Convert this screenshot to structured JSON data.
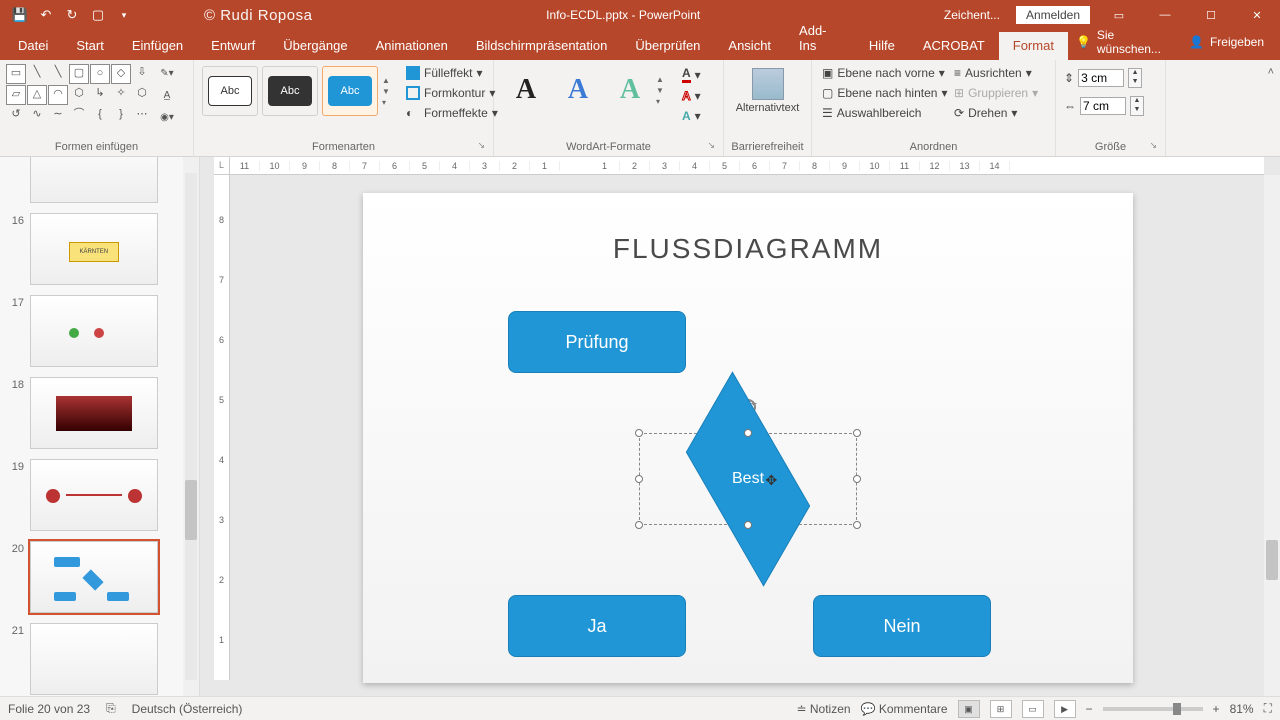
{
  "titlebar": {
    "author": "© Rudi Roposa",
    "filename": "Info-ECDL.pptx - PowerPoint",
    "draw": "Zeichent...",
    "signin": "Anmelden"
  },
  "tabs": {
    "items": [
      "Datei",
      "Start",
      "Einfügen",
      "Entwurf",
      "Übergänge",
      "Animationen",
      "Bildschirmpräsentation",
      "Überprüfen",
      "Ansicht",
      "Add-Ins",
      "Hilfe",
      "ACROBAT",
      "Format"
    ],
    "active": 12,
    "tell": "Sie wünschen...",
    "share": "Freigeben"
  },
  "ribbon": {
    "groups": {
      "insert_shapes": "Formen einfügen",
      "shape_styles": "Formenarten",
      "wordart": "WordArt-Formate",
      "accessibility": "Barrierefreiheit",
      "arrange": "Anordnen",
      "size": "Größe"
    },
    "shape_effects": {
      "fill": "Fülleffekt",
      "outline": "Formkontur",
      "effects": "Formeffekte"
    },
    "style_thumbs_label": "Abc",
    "alt_text": "Alternativtext",
    "arrange": {
      "bring_forward": "Ebene nach vorne",
      "send_backward": "Ebene nach hinten",
      "selection_pane": "Auswahlbereich",
      "align": "Ausrichten",
      "group": "Gruppieren",
      "rotate": "Drehen"
    },
    "size": {
      "height": "3 cm",
      "width": "7 cm"
    }
  },
  "ruler": {
    "h": [
      "11",
      "10",
      "9",
      "8",
      "7",
      "6",
      "5",
      "4",
      "3",
      "2",
      "1",
      "",
      "1",
      "2",
      "3",
      "4",
      "5",
      "6",
      "7",
      "8",
      "9",
      "10",
      "11",
      "12",
      "13",
      "14"
    ],
    "v": [
      "",
      "8",
      "",
      "7",
      "",
      "6",
      "",
      "5",
      "",
      "4",
      "",
      "3",
      "",
      "2",
      "",
      "1",
      "",
      ""
    ]
  },
  "thumbs": {
    "visible": [
      16,
      17,
      18,
      19,
      20,
      21
    ],
    "active": 20
  },
  "slide": {
    "title": "FLUSSDIAGRAMM",
    "box1": "Prüfung",
    "diamond": "Best",
    "box_yes": "Ja",
    "box_no": "Nein"
  },
  "status": {
    "slide": "Folie 20 von 23",
    "lang": "Deutsch (Österreich)",
    "notes": "Notizen",
    "comments": "Kommentare",
    "zoom": "81%"
  }
}
